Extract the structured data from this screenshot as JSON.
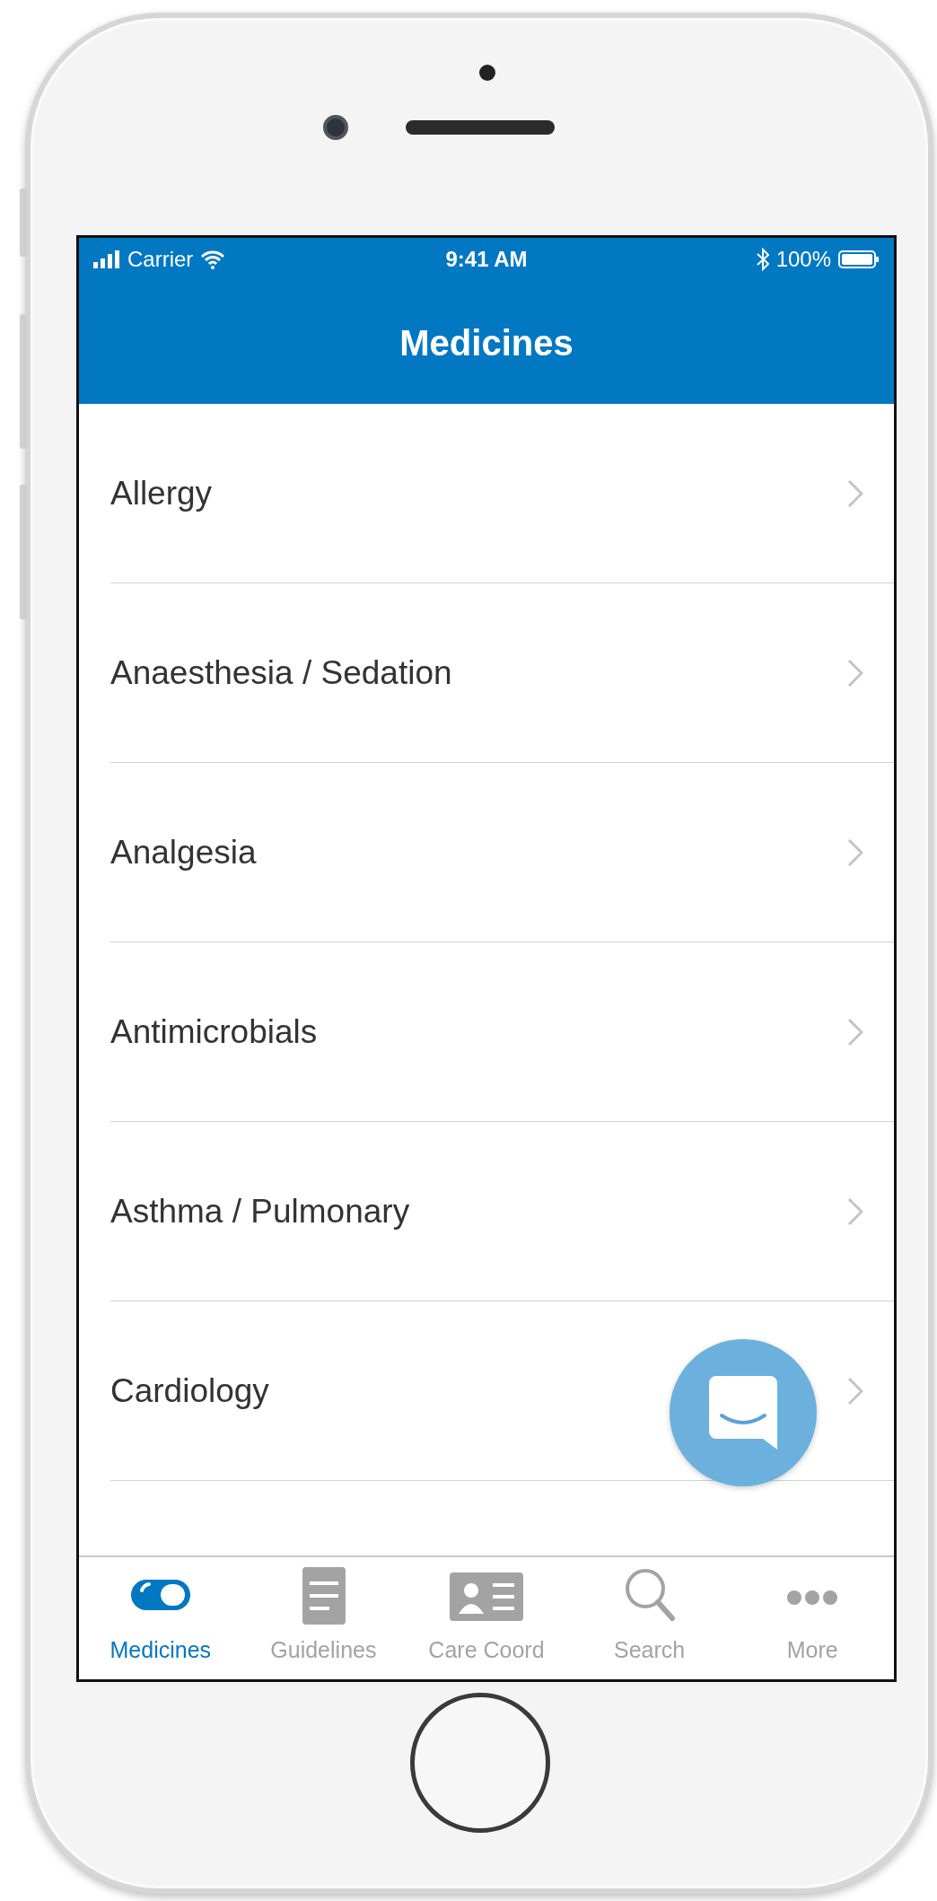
{
  "status_bar": {
    "carrier": "Carrier",
    "time": "9:41 AM",
    "battery": "100%"
  },
  "nav_bar": {
    "title": "Medicines"
  },
  "list": {
    "items": [
      {
        "label": "Allergy"
      },
      {
        "label": "Anaesthesia / Sedation"
      },
      {
        "label": "Analgesia"
      },
      {
        "label": "Antimicrobials"
      },
      {
        "label": "Asthma / Pulmonary"
      },
      {
        "label": "Cardiology"
      }
    ]
  },
  "tab_bar": {
    "tabs": [
      {
        "label": "Medicines",
        "kind": "pill",
        "selected": true
      },
      {
        "label": "Guidelines",
        "kind": "notepad",
        "selected": false
      },
      {
        "label": "Care Coord",
        "kind": "card",
        "selected": false
      },
      {
        "label": "Search",
        "kind": "search",
        "selected": false
      },
      {
        "label": "More",
        "kind": "more",
        "selected": false
      }
    ]
  }
}
